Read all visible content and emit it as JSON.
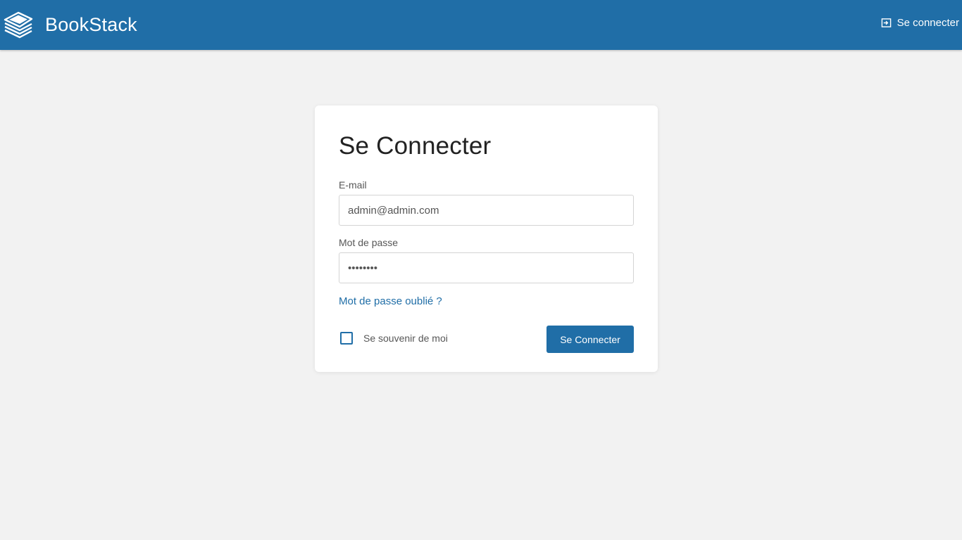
{
  "brand": {
    "name": "BookStack",
    "icon": "bookstack-logo-icon",
    "header_color": "#206ea7"
  },
  "header": {
    "login_link_label": "Se connecter",
    "login_icon": "login-icon"
  },
  "login_form": {
    "title": "Se Connecter",
    "email_label": "E-mail",
    "email_value": "admin@admin.com",
    "password_label": "Mot de passe",
    "password_value": "password",
    "forgot_password_label": "Mot de passe oublié ?",
    "remember_me_label": "Se souvenir de moi",
    "remember_me_checked": false,
    "submit_label": "Se Connecter"
  },
  "colors": {
    "accent": "#206ea7",
    "background": "#f2f2f2",
    "card": "#ffffff"
  }
}
